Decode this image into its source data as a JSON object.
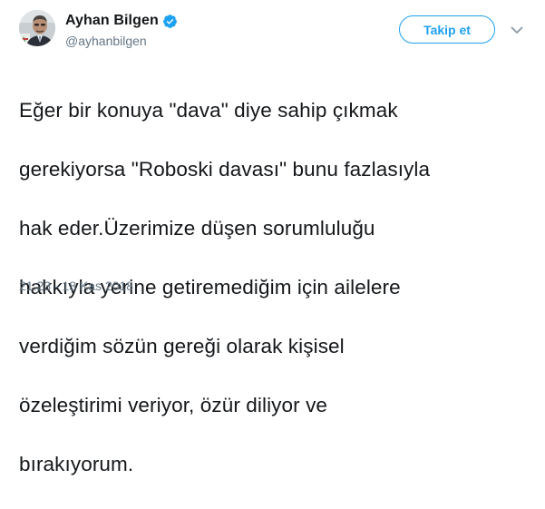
{
  "author": {
    "display_name": "Ayhan Bilgen",
    "handle": "@ayhanbilgen",
    "verified": true
  },
  "actions": {
    "follow_label": "Takip et"
  },
  "tweet": {
    "text_lines": [
      "Eğer bir konuya \"dava\" diye sahip çıkmak",
      "gerekiyorsa \"Roboski davası\" bunu fazlasıyla",
      "hak eder.Üzerimize düşen sorumluluğu",
      "hakkıyla yerine getiremediğim için ailelere",
      "verdiğim sözün gereği olarak kişisel",
      "özeleştirimi veriyor, özür diliyor ve",
      "bırakıyorum."
    ],
    "timestamp": "21:23 - 18 Kas 2018"
  },
  "icons": {
    "verified": "verified-badge-icon",
    "caret": "chevron-down-icon",
    "avatar": "profile-photo"
  },
  "colors": {
    "accent": "#1da1f2",
    "text": "#14171a",
    "secondary_text": "#657786",
    "background": "#ffffff"
  }
}
